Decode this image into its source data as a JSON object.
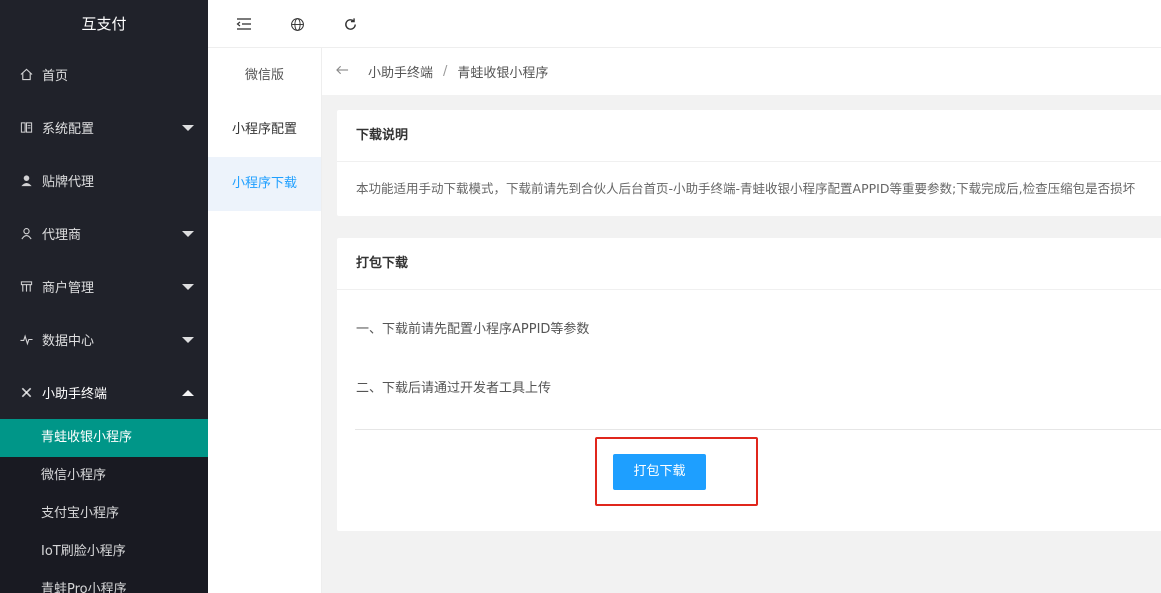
{
  "sidebar": {
    "logo": "互支付",
    "items": [
      {
        "label": "首页",
        "icon": "home-icon"
      },
      {
        "label": "系统配置",
        "icon": "settings-icon"
      },
      {
        "label": "贴牌代理",
        "icon": "user-icon"
      },
      {
        "label": "代理商",
        "icon": "agent-icon"
      },
      {
        "label": "商户管理",
        "icon": "store-icon"
      },
      {
        "label": "数据中心",
        "icon": "pulse-icon"
      },
      {
        "label": "小助手终端",
        "icon": "tools-icon"
      }
    ],
    "subitems": [
      {
        "label": "青蛙收银小程序",
        "active": true
      },
      {
        "label": "微信小程序"
      },
      {
        "label": "支付宝小程序"
      },
      {
        "label": "IoT刷脸小程序"
      },
      {
        "label": "青蛙Pro小程序"
      }
    ]
  },
  "header": {
    "icons": [
      "collapse-menu-icon",
      "globe-icon",
      "refresh-icon"
    ]
  },
  "tabmenu": {
    "items": [
      {
        "label": "微信版"
      },
      {
        "label": "小程序配置"
      },
      {
        "label": "小程序下载",
        "active": true
      }
    ]
  },
  "breadcrumb": {
    "items": [
      "小助手终端",
      "青蛙收银小程序"
    ],
    "separator": "/"
  },
  "card_description": {
    "title": "下载说明",
    "text": "本功能适用手动下载模式，下载前请先到合伙人后台首页-小助手终端-青蛙收银小程序配置APPID等重要参数;下载完成后,检查压缩包是否损坏"
  },
  "card_download": {
    "title": "打包下载",
    "step1": "一、下载前请先配置小程序APPID等参数",
    "step2": "二、下载后请通过开发者工具上传",
    "button_label": "打包下载"
  },
  "colors": {
    "sidebar_bg": "#20222a",
    "active_green": "#009688",
    "primary_blue": "#1e9fff",
    "highlight_red": "#e0261c"
  }
}
